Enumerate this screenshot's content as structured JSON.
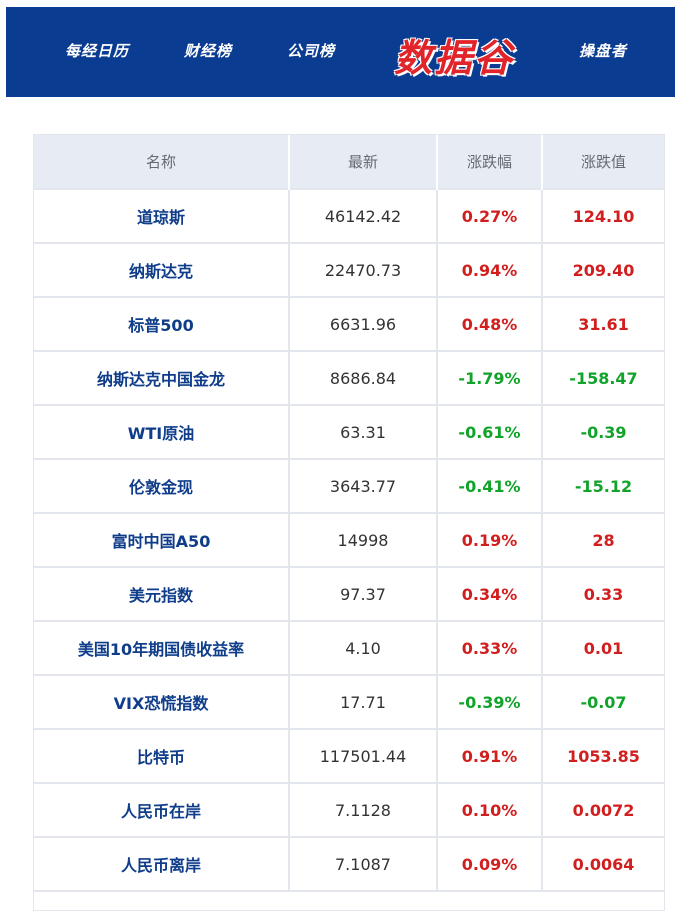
{
  "header": {
    "nav_items": [
      "每经日历",
      "财经榜",
      "公司榜",
      "操盘者"
    ],
    "logo": "数据谷",
    "bg_color": "#0a3d91",
    "logo_color": "#e0242a"
  },
  "table": {
    "columns": [
      "名称",
      "最新",
      "涨跌幅",
      "涨跌值"
    ],
    "rows": [
      {
        "name": "道琼斯",
        "latest": "46142.42",
        "pct": "0.27%",
        "chg": "124.10",
        "dir": "up"
      },
      {
        "name": "纳斯达克",
        "latest": "22470.73",
        "pct": "0.94%",
        "chg": "209.40",
        "dir": "up"
      },
      {
        "name": "标普500",
        "latest": "6631.96",
        "pct": "0.48%",
        "chg": "31.61",
        "dir": "up"
      },
      {
        "name": "纳斯达克中国金龙",
        "latest": "8686.84",
        "pct": "-1.79%",
        "chg": "-158.47",
        "dir": "down"
      },
      {
        "name": "WTI原油",
        "latest": "63.31",
        "pct": "-0.61%",
        "chg": "-0.39",
        "dir": "down"
      },
      {
        "name": "伦敦金现",
        "latest": "3643.77",
        "pct": "-0.41%",
        "chg": "-15.12",
        "dir": "down"
      },
      {
        "name": "富时中国A50",
        "latest": "14998",
        "pct": "0.19%",
        "chg": "28",
        "dir": "up"
      },
      {
        "name": "美元指数",
        "latest": "97.37",
        "pct": "0.34%",
        "chg": "0.33",
        "dir": "up"
      },
      {
        "name": "美国10年期国债收益率",
        "latest": "4.10",
        "pct": "0.33%",
        "chg": "0.01",
        "dir": "up"
      },
      {
        "name": "VIX恐慌指数",
        "latest": "17.71",
        "pct": "-0.39%",
        "chg": "-0.07",
        "dir": "down"
      },
      {
        "name": "比特币",
        "latest": "117501.44",
        "pct": "0.91%",
        "chg": "1053.85",
        "dir": "up"
      },
      {
        "name": "人民币在岸",
        "latest": "7.1128",
        "pct": "0.10%",
        "chg": "0.0072",
        "dir": "up"
      },
      {
        "name": "人民币离岸",
        "latest": "7.1087",
        "pct": "0.09%",
        "chg": "0.0064",
        "dir": "up"
      }
    ]
  },
  "colors": {
    "up": "#d11f1f",
    "down": "#12a32a",
    "name": "#0f3d8a"
  }
}
